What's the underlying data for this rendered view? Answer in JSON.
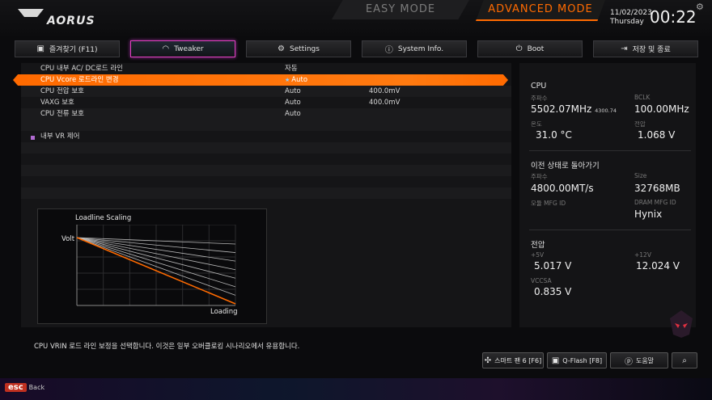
{
  "header": {
    "logo": "AORUS",
    "easy_mode": "EASY MODE",
    "advanced_mode": "ADVANCED MODE",
    "date": "11/02/2023",
    "weekday": "Thursday",
    "time": "00:22",
    "settings_icon": "gear-icon"
  },
  "tabs": [
    {
      "label": "즐겨찾기 (F11)",
      "icon": "favorite-icon"
    },
    {
      "label": "Tweaker",
      "icon": "gauge-icon"
    },
    {
      "label": "Settings",
      "icon": "gear-icon"
    },
    {
      "label": "System Info.",
      "icon": "info-icon"
    },
    {
      "label": "Boot",
      "icon": "power-icon"
    },
    {
      "label": "저장 및 종료",
      "icon": "exit-icon"
    }
  ],
  "settings": [
    {
      "label": "CPU 내부 AC/ DC로드 라인",
      "value": "자동",
      "value2": ""
    },
    {
      "label": "CPU Vcore 로드라인 변경",
      "value": "Auto",
      "value2": ""
    },
    {
      "label": "CPU 전압 보호",
      "value": "Auto",
      "value2": "400.0mV"
    },
    {
      "label": "VAXG 보호",
      "value": "Auto",
      "value2": "400.0mV"
    },
    {
      "label": "CPU 전류 보호",
      "value": "Auto",
      "value2": ""
    }
  ],
  "submenu": {
    "label": "내부 VR 제어"
  },
  "chart": {
    "title": "Loadline Scaling",
    "y_label": "Volt",
    "x_label": "Loading",
    "line_count": 8,
    "highlight_index": 7,
    "accent": "#ff6a00"
  },
  "cpu": {
    "heading": "CPU",
    "freq_label": "주파수",
    "freq_value": "5502.07MHz",
    "freq_sub": "4300.74",
    "bclk_label": "BCLK",
    "bclk_value": "100.00MHz",
    "temp_label": "온도",
    "temp_value": "31.0 °C",
    "volt_label": "전압",
    "volt_value": "1.068 V"
  },
  "memory": {
    "heading": "이전 상태로 돌아가기",
    "freq_label": "주파수",
    "freq_value": "4800.00MT/s",
    "size_label": "Size",
    "size_value": "32768MB",
    "mfg_label": "모듈 MFG ID",
    "dram_label": "DRAM MFG ID",
    "dram_value": "Hynix"
  },
  "voltage": {
    "heading": "전압",
    "v5_label": "+5V",
    "v5_value": "5.017 V",
    "v12_label": "+12V",
    "v12_value": "12.024 V",
    "vccsa_label": "VCCSA",
    "vccsa_value": "0.835 V"
  },
  "help_text": "CPU VRIN 로드 라인 보정을 선택합니다. 이것은 일부 오버클로킹 시나리오에서 유용합니다.",
  "bottom_buttons": [
    {
      "label": "스마트 팬 6 [F6]",
      "icon": "fan-icon"
    },
    {
      "label": "Q-Flash [F8]",
      "icon": "flash-icon"
    },
    {
      "label": "도움말",
      "icon": "help-icon"
    },
    {
      "label": "",
      "icon": "search-icon"
    }
  ],
  "esc": {
    "key": "esc",
    "label": "Back"
  }
}
